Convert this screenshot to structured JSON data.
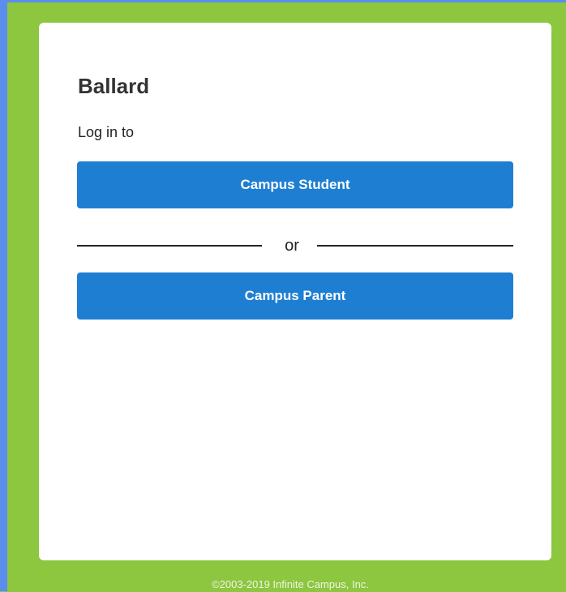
{
  "colors": {
    "background": "#8dc63f",
    "frame": "#5b8def",
    "card": "#ffffff",
    "button": "#1e7fd2",
    "button_text": "#ffffff"
  },
  "card": {
    "title": "Ballard",
    "subtitle": "Log in to",
    "student_button": "Campus Student",
    "separator": "or",
    "parent_button": "Campus Parent"
  },
  "footer": {
    "copyright": "©2003-2019 Infinite Campus, Inc."
  }
}
